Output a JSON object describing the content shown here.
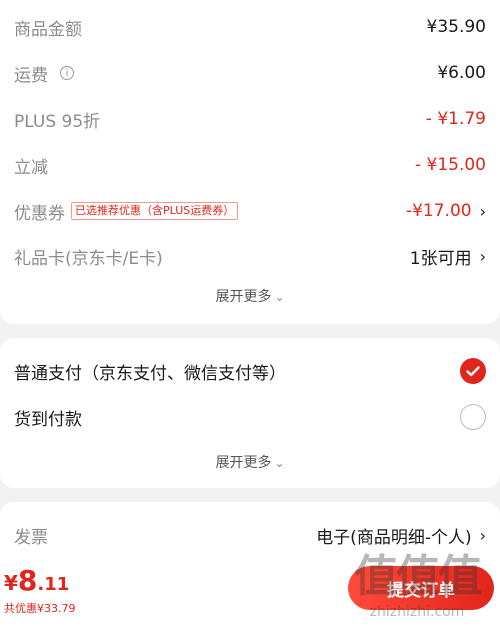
{
  "summary": {
    "rows": [
      {
        "label": "商品金额",
        "value": "¥35.90"
      },
      {
        "label": "运费",
        "value": "¥6.00"
      },
      {
        "label": "PLUS 95折",
        "value": "- ¥1.79"
      },
      {
        "label": "立减",
        "value": "- ¥15.00"
      },
      {
        "label": "优惠券",
        "badge": "已选推荐优惠（含PLUS运费券）",
        "value": "-¥17.00"
      },
      {
        "label": "礼品卡(京东卡/E卡)",
        "value": "1张可用"
      }
    ],
    "expand_label": "展开更多"
  },
  "payment": {
    "options": [
      {
        "label": "普通支付（京东支付、微信支付等）",
        "selected": true
      },
      {
        "label": "货到付款",
        "selected": false
      }
    ],
    "expand_label": "展开更多"
  },
  "invoice": {
    "label": "发票",
    "value": "电子(商品明细-个人)"
  },
  "footer": {
    "currency": "¥",
    "total_int": "8",
    "total_dec": ".11",
    "discount": "共优惠¥33.79",
    "submit_label": "提交订单"
  },
  "watermark": {
    "logo_text": "值值值",
    "site": "zhizhizhi.com"
  },
  "colors": {
    "accent": "#e1251b",
    "muted": "#8c8c8c",
    "background": "#f2f2f2"
  },
  "icons": {
    "info": "info-circle-icon",
    "chevron": "chevron-right-icon",
    "expand": "chevron-down-icon",
    "check": "check-icon"
  }
}
